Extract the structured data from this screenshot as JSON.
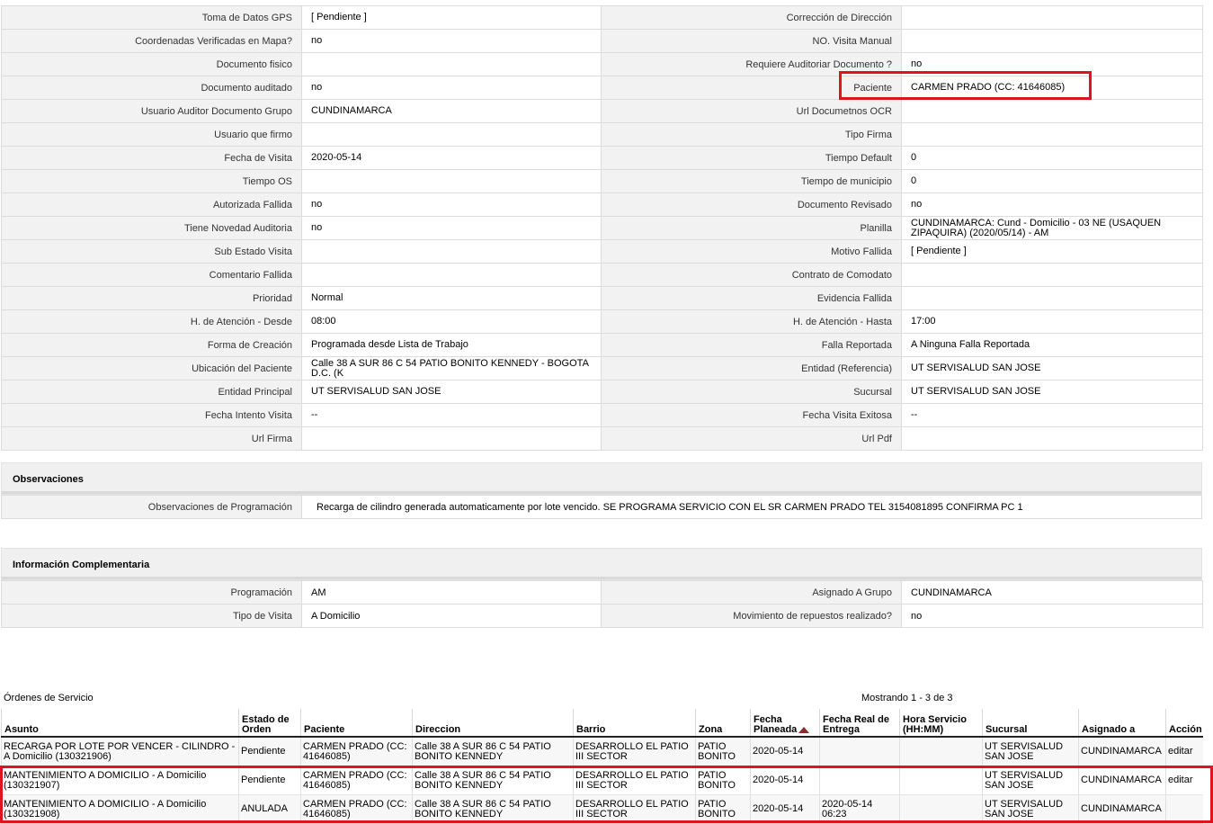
{
  "detail_rows": [
    {
      "l1": "Toma de Datos GPS",
      "v1": "[ Pendiente ]",
      "l2": "Corrección de Dirección",
      "v2": ""
    },
    {
      "l1": "Coordenadas Verificadas en Mapa?",
      "v1": " no",
      "l2": "NO. Visita Manual",
      "v2": ""
    },
    {
      "l1": "Documento fisico",
      "v1": "",
      "l2": "Requiere Auditoriar Documento ?",
      "v2": " no"
    },
    {
      "l1": "Documento auditado",
      "v1": " no",
      "l2": "Paciente",
      "v2": "CARMEN PRADO (CC: 41646085)"
    },
    {
      "l1": "Usuario Auditor Documento Grupo",
      "v1": "CUNDINAMARCA",
      "l2": "Url Documetnos OCR",
      "v2": ""
    },
    {
      "l1": "Usuario que firmo",
      "v1": "",
      "l2": "Tipo Firma",
      "v2": ""
    },
    {
      "l1": "Fecha de Visita",
      "v1": " 2020-05-14",
      "l2": "Tiempo Default",
      "v2": "0"
    },
    {
      "l1": "Tiempo OS",
      "v1": "",
      "l2": "Tiempo de municipio",
      "v2": "0"
    },
    {
      "l1": "Autorizada Fallida",
      "v1": " no",
      "l2": "Documento Revisado",
      "v2": " no"
    },
    {
      "l1": "Tiene Novedad Auditoria",
      "v1": " no",
      "l2": "Planilla",
      "v2": "CUNDINAMARCA: Cund - Domicilio - 03 NE (USAQUEN ZIPAQUIRA) (2020/05/14) - AM"
    },
    {
      "l1": "Sub Estado Visita",
      "v1": "",
      "l2": "Motivo Fallida",
      "v2": "[ Pendiente ]"
    },
    {
      "l1": "Comentario Fallida",
      "v1": "",
      "l2": "Contrato de Comodato",
      "v2": ""
    },
    {
      "l1": "Prioridad",
      "v1": "Normal",
      "l2": "Evidencia Fallida",
      "v2": ""
    },
    {
      "l1": "H. de Atención - Desde",
      "v1": "08:00",
      "l2": "H. de Atención - Hasta",
      "v2": "17:00"
    },
    {
      "l1": "Forma de Creación",
      "v1": "Programada desde Lista de Trabajo",
      "l2": "Falla Reportada",
      "v2": "A Ninguna Falla Reportada"
    },
    {
      "l1": "Ubicación del Paciente",
      "v1": "Calle 38 A SUR 86 C 54 PATIO BONITO KENNEDY - BOGOTA D.C. (K",
      "l2": "Entidad (Referencia)",
      "v2": "UT SERVISALUD SAN JOSE"
    },
    {
      "l1": "Entidad Principal",
      "v1": "UT SERVISALUD SAN JOSE",
      "l2": "Sucursal",
      "v2": "UT SERVISALUD SAN JOSE"
    },
    {
      "l1": "Fecha Intento Visita",
      "v1": " --",
      "l2": "Fecha Visita Exitosa",
      "v2": " --"
    },
    {
      "l1": "Url Firma",
      "v1": "",
      "l2": "Url Pdf",
      "v2": ""
    }
  ],
  "observaciones": {
    "title": "Observaciones",
    "label": "Observaciones de Programación",
    "value": "Recarga de cilindro generada automaticamente por lote vencido. SE PROGRAMA SERVICIO CON EL SR CARMEN PRADO TEL 3154081895 CONFIRMA PC 1"
  },
  "complementaria": {
    "title": "Información Complementaria",
    "rows": [
      {
        "l1": "Programación",
        "v1": "AM",
        "l2": "Asignado A Grupo",
        "v2": "CUNDINAMARCA"
      },
      {
        "l1": "Tipo de Visita",
        "v1": "A Domicilio",
        "l2": "Movimiento de repuestos realizado?",
        "v2": " no"
      }
    ]
  },
  "orders": {
    "title": "Órdenes de Servicio",
    "count": "Mostrando 1 - 3 de 3",
    "headers": [
      "Asunto",
      "Estado de Orden",
      "Paciente",
      "Direccion",
      "Barrio",
      "Zona",
      "Fecha Planeada",
      "Fecha Real de Entrega",
      "Hora Servicio (HH:MM)",
      "Sucursal",
      "Asignado a",
      "Acción"
    ],
    "sort_icon": "sort-asc-icon",
    "rows": [
      {
        "asunto": "RECARGA POR LOTE POR VENCER - CILINDRO - A Domicilio (130321906)",
        "estado": "Pendiente",
        "paciente": "CARMEN PRADO (CC: 41646085)",
        "direccion": "Calle 38 A SUR 86 C 54 PATIO BONITO KENNEDY",
        "barrio": "DESARROLLO EL PATIO III SECTOR",
        "zona": "PATIO BONITO",
        "fecha_plan": "2020-05-14",
        "fecha_real": "",
        "hora": "",
        "sucursal": "UT SERVISALUD SAN JOSE",
        "asignado": "CUNDINAMARCA",
        "accion": "editar"
      },
      {
        "asunto": "MANTENIMIENTO A DOMICILIO - A Domicilio (130321907)",
        "estado": "Pendiente",
        "paciente": "CARMEN PRADO (CC: 41646085)",
        "direccion": "Calle 38 A SUR 86 C 54 PATIO BONITO KENNEDY",
        "barrio": "DESARROLLO EL PATIO III SECTOR",
        "zona": "PATIO BONITO",
        "fecha_plan": "2020-05-14",
        "fecha_real": "",
        "hora": "",
        "sucursal": "UT SERVISALUD SAN JOSE",
        "asignado": "CUNDINAMARCA",
        "accion": "editar"
      },
      {
        "asunto": "MANTENIMIENTO A DOMICILIO - A Domicilio (130321908)",
        "estado": "ANULADA",
        "paciente": "CARMEN PRADO (CC: 41646085)",
        "direccion": "Calle 38 A SUR 86 C 54 PATIO BONITO KENNEDY",
        "barrio": "DESARROLLO EL PATIO III SECTOR",
        "zona": "PATIO BONITO",
        "fecha_plan": "2020-05-14",
        "fecha_real": "2020-05-14 06:23",
        "hora": "",
        "sucursal": "UT SERVISALUD SAN JOSE",
        "asignado": "CUNDINAMARCA",
        "accion": ""
      }
    ]
  },
  "highlight_color": "#e0141c"
}
